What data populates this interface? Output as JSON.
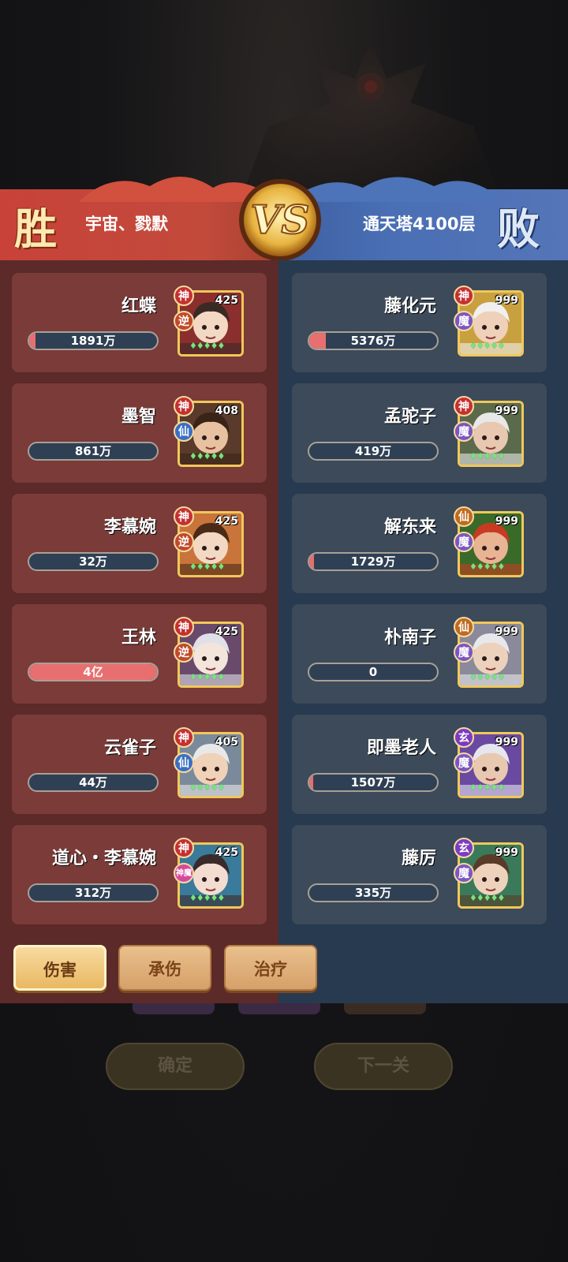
{
  "header": {
    "win_mark": "胜",
    "lose_mark": "败",
    "player_name": "宇宙、戮默",
    "enemy_name": "通天塔4100层",
    "vs_text": "VS"
  },
  "left_team": [
    {
      "name": "红蝶",
      "level": "425",
      "badge_top": "神",
      "badge_bot": "逆",
      "value": "1891万",
      "bar_fraction": 0.05
    },
    {
      "name": "墨智",
      "level": "408",
      "badge_top": "神",
      "badge_bot": "仙",
      "value": "861万",
      "bar_fraction": 0.0
    },
    {
      "name": "李慕婉",
      "level": "425",
      "badge_top": "神",
      "badge_bot": "逆",
      "value": "32万",
      "bar_fraction": 0.0
    },
    {
      "name": "王林",
      "level": "425",
      "badge_top": "神",
      "badge_bot": "逆",
      "value": "4亿",
      "bar_fraction": 1.0
    },
    {
      "name": "云雀子",
      "level": "405",
      "badge_top": "神",
      "badge_bot": "仙",
      "value": "44万",
      "bar_fraction": 0.0
    },
    {
      "name": "道心・李慕婉",
      "level": "425",
      "badge_top": "神",
      "badge_bot": "神魔",
      "value": "312万",
      "bar_fraction": 0.0
    }
  ],
  "right_team": [
    {
      "name": "藤化元",
      "level": "999",
      "badge_top": "神",
      "badge_bot": "魔",
      "value": "5376万",
      "bar_fraction": 0.13
    },
    {
      "name": "孟驼子",
      "level": "999",
      "badge_top": "神",
      "badge_bot": "魔",
      "value": "419万",
      "bar_fraction": 0.0
    },
    {
      "name": "解东来",
      "level": "999",
      "badge_top": "仙",
      "badge_bot": "魔",
      "value": "1729万",
      "bar_fraction": 0.04
    },
    {
      "name": "朴南子",
      "level": "999",
      "badge_top": "仙",
      "badge_bot": "魔",
      "value": "0",
      "bar_fraction": 0.0
    },
    {
      "name": "即墨老人",
      "level": "999",
      "badge_top": "玄",
      "badge_bot": "魔",
      "value": "1507万",
      "bar_fraction": 0.03
    },
    {
      "name": "藤厉",
      "level": "999",
      "badge_top": "玄",
      "badge_bot": "魔",
      "value": "335万",
      "bar_fraction": 0.0
    }
  ],
  "tabs": {
    "damage": "伤害",
    "taken": "承伤",
    "heal": "治疗",
    "active": "damage"
  },
  "bottom": {
    "confirm": "确定",
    "next_level": "下一关"
  },
  "colors": {
    "win_red": "#c8423a",
    "lose_blue": "#4a6fb4",
    "bar_fill": "#e86f6f",
    "bar_bg": "#2f4054",
    "portrait_border": "#f0c85a"
  }
}
